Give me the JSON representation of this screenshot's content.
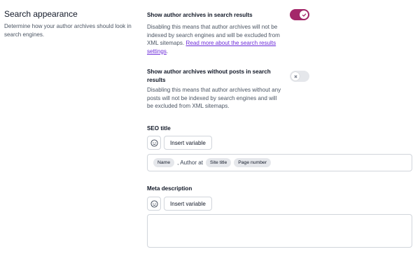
{
  "section": {
    "title": "Search appearance",
    "description": "Determine how your author archives should look in search engines."
  },
  "option1": {
    "title": "Show author archives in search results",
    "description": "Disabling this means that author archives will not be indexed by search engines and will be excluded from XML sitemaps.",
    "link": "Read more about the search results settings",
    "after_link": ".",
    "enabled": true
  },
  "option2": {
    "title": "Show author archives without posts in search results",
    "description": "Disabling this means that author archives without any posts will not be indexed by search engines and will be excluded from XML sitemaps.",
    "enabled": false
  },
  "seo_title": {
    "label": "SEO title",
    "insert_label": "Insert variable",
    "tokens": [
      {
        "type": "var",
        "text": "Name"
      },
      {
        "type": "text",
        "text": ", Author at"
      },
      {
        "type": "var",
        "text": "Site title"
      },
      {
        "type": "var",
        "text": "Page number"
      }
    ]
  },
  "meta_description": {
    "label": "Meta description",
    "insert_label": "Insert variable",
    "value": ""
  },
  "colors": {
    "toggle_on": "#a4286a",
    "toggle_off": "#e5e7eb",
    "link": "#6c2bd9"
  },
  "icons": {
    "toggle_on": "check-icon",
    "toggle_off": "x-icon",
    "emoji": "smiley-icon"
  }
}
